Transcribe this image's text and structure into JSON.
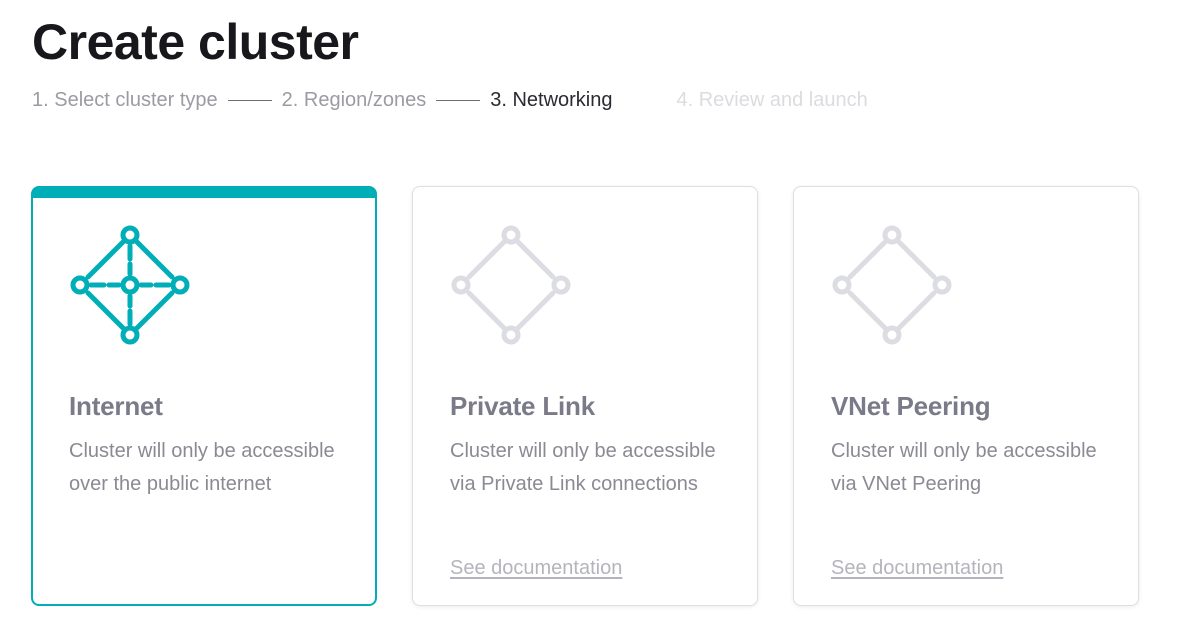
{
  "page": {
    "title": "Create cluster"
  },
  "steps": [
    {
      "label": "1. Select cluster type",
      "state": "done"
    },
    {
      "label": "2. Region/zones",
      "state": "done"
    },
    {
      "label": "3. Networking",
      "state": "current"
    },
    {
      "label": "4. Review and launch",
      "state": "future"
    }
  ],
  "options": [
    {
      "title": "Internet",
      "description": "Cluster will only be accessible over the public internet",
      "link": "",
      "selected": true,
      "icon": "network-full-mesh-icon"
    },
    {
      "title": "Private Link",
      "description": "Cluster will only be accessible via Private Link connections",
      "link": "See documentation",
      "selected": false,
      "icon": "network-diamond-icon"
    },
    {
      "title": "VNet Peering",
      "description": "Cluster will only be accessible via VNet Peering",
      "link": "See documentation",
      "selected": false,
      "icon": "network-diamond-icon"
    }
  ],
  "colors": {
    "accent": "#00aeb8",
    "muted_icon": "#dcdce3"
  }
}
